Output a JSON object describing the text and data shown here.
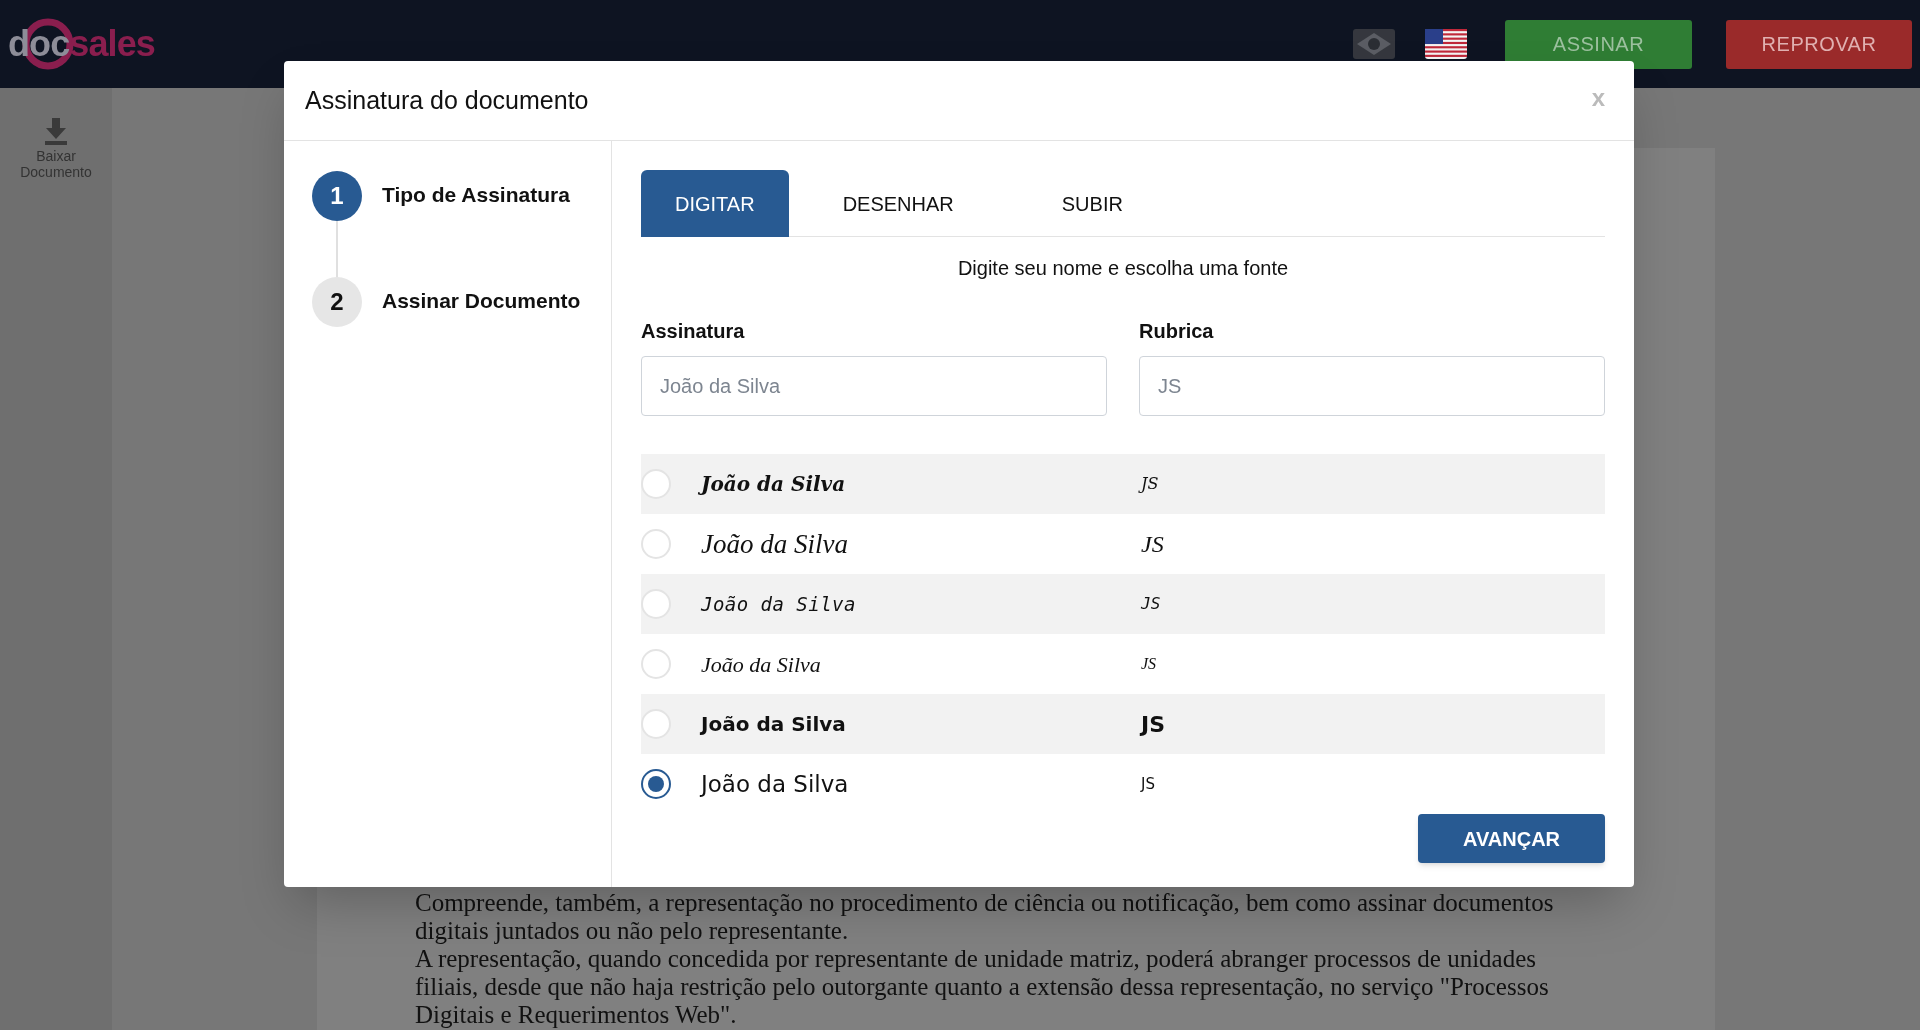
{
  "header": {
    "logo": {
      "part_1": "doc",
      "part_2": "sales"
    },
    "languages": [
      {
        "kind": "br",
        "selected": false
      },
      {
        "kind": "us",
        "selected": true
      }
    ],
    "buttons": [
      {
        "label": "ASSINAR",
        "kind": "approve"
      },
      {
        "label": "REPROVAR",
        "kind": "reject"
      }
    ]
  },
  "sidebar": {
    "items": [
      {
        "label": "Baixar Documento"
      }
    ]
  },
  "document": {
    "paragraphs": [
      "Compreende, também, a representação no procedimento de ciência ou notificação, bem como assinar documentos digitais juntados ou não pelo representante.",
      "A representação, quando concedida por representante de unidade matriz, poderá abranger processos de unidades filiais, desde que não haja restrição pelo outorgante quanto a extensão dessa representação, no serviço \"Processos Digitais e Requerimentos Web\"."
    ]
  },
  "dialog": {
    "title": "Assinatura do documento",
    "close": "x",
    "steps": [
      {
        "number": "1",
        "label": "Tipo de Assinatura",
        "selected": true
      },
      {
        "number": "2",
        "label": "Assinar Documento",
        "selected": false
      }
    ],
    "tabs": [
      {
        "label": "DIGITAR",
        "selected": true
      },
      {
        "label": "DESENHAR",
        "selected": false
      },
      {
        "label": "SUBIR",
        "selected": false
      }
    ],
    "instruction": "Digite seu nome e escolha uma fonte",
    "fields": [
      {
        "label": "Assinatura",
        "placeholder": "João da Silva"
      },
      {
        "label": "Rubrica",
        "placeholder": "JS"
      }
    ],
    "options": [
      {
        "kind": "brush",
        "signature": "João da Silva",
        "initials": "JS",
        "selected": false
      },
      {
        "kind": "script",
        "signature": "João da Silva",
        "initials": "JS",
        "selected": false
      },
      {
        "kind": "hand",
        "signature": "João da Silva",
        "initials": "JS",
        "selected": false
      },
      {
        "kind": "italic",
        "signature": "João da Silva",
        "initials": "JS",
        "selected": false
      },
      {
        "kind": "bold",
        "signature": "João da Silva",
        "initials": "JS",
        "selected": false
      },
      {
        "kind": "plain",
        "signature": "João da Silva",
        "initials": "JS",
        "selected": true
      }
    ],
    "button": "AVANÇAR"
  }
}
